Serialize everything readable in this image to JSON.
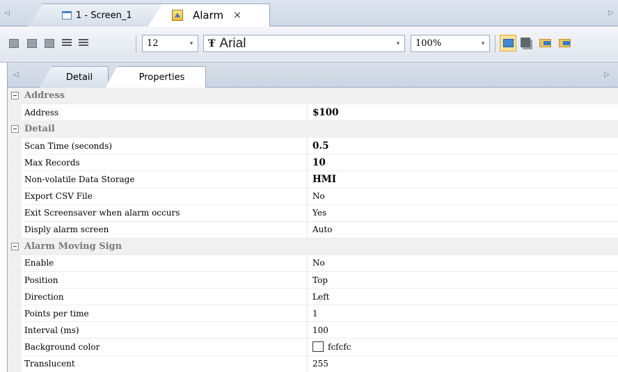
{
  "doc_tabs": [
    {
      "label": "1 - Screen_1",
      "icon": "screen-icon"
    },
    {
      "label": "Alarm",
      "icon": "alarm-icon",
      "close": "×"
    }
  ],
  "toolbar": {
    "font_size": "12",
    "font_family": "Arial",
    "font_icon": "Ŧ",
    "zoom": "100%"
  },
  "sub_tabs": [
    "Detail",
    "Properties"
  ],
  "grid": {
    "categories": [
      {
        "title": "Address",
        "rows": [
          {
            "name": "Address",
            "value": "$100",
            "bold": true
          }
        ]
      },
      {
        "title": "Detail",
        "rows": [
          {
            "name": "Scan Time (seconds)",
            "value": "0.5",
            "bold": true
          },
          {
            "name": "Max Records",
            "value": "10",
            "bold": true
          },
          {
            "name": "Non-volatile Data Storage",
            "value": "HMI",
            "bold": true
          },
          {
            "name": "Export CSV File",
            "value": "No"
          },
          {
            "name": "Exit Screensaver when alarm occurs",
            "value": "Yes"
          },
          {
            "name": "Disply alarm screen",
            "value": "Auto"
          }
        ]
      },
      {
        "title": "Alarm Moving Sign",
        "rows": [
          {
            "name": "Enable",
            "value": "No"
          },
          {
            "name": "Position",
            "value": "Top"
          },
          {
            "name": "Direction",
            "value": "Left"
          },
          {
            "name": "Points per time",
            "value": "1"
          },
          {
            "name": "Interval (ms)",
            "value": "100"
          },
          {
            "name": "Background color",
            "value": "fcfcfc",
            "swatch": "#fcfcfc"
          },
          {
            "name": "Translucent",
            "value": "255"
          }
        ]
      }
    ]
  },
  "colors": {
    "tab_bar": "#cfd8e6",
    "category_bg": "#f0f0f0",
    "active_toolbar_button": "#fbe29a"
  }
}
